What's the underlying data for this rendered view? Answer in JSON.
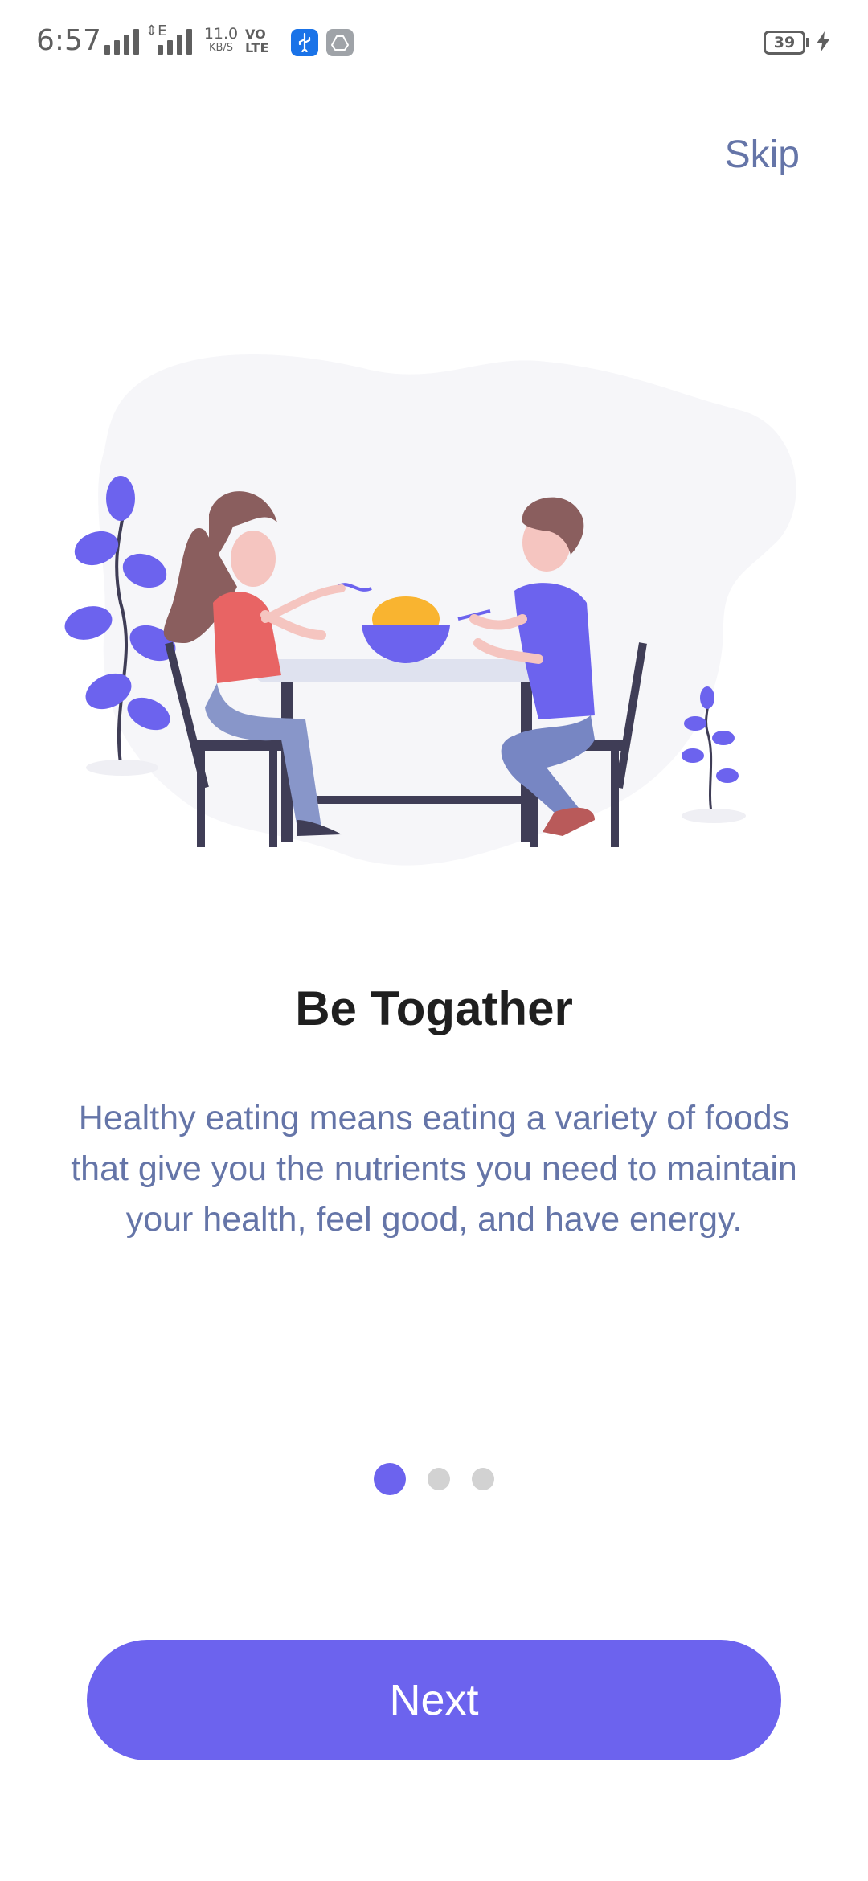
{
  "status_bar": {
    "time": "6:57",
    "net_arrows": "⇕E",
    "speed_value": "11.0",
    "speed_unit": "KB/S",
    "volte_top": "VO",
    "volte_bottom": "LTE",
    "battery": "39"
  },
  "skip_label": "Skip",
  "slide": {
    "title": "Be Togather",
    "description": "Healthy eating means eating a variety of foods that give you the nutrients you need to maintain your health, feel good, and have energy."
  },
  "pager": {
    "count": 3,
    "active_index": 0
  },
  "next_label": "Next",
  "colors": {
    "accent": "#6c63ee",
    "text_muted": "#6575a8",
    "title": "#1f1f1f",
    "dot_inactive": "#d2d2d2"
  }
}
